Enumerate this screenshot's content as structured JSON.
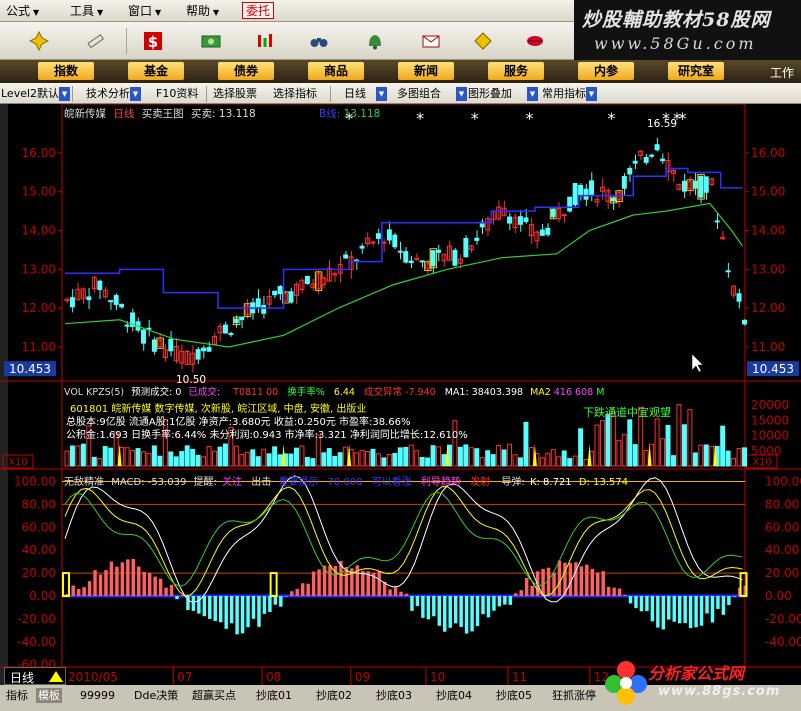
{
  "menu": {
    "items": [
      {
        "id": "formula",
        "label": "公式"
      },
      {
        "id": "tools",
        "label": "工具"
      },
      {
        "id": "window",
        "label": "窗口"
      },
      {
        "id": "help",
        "label": "帮助"
      }
    ],
    "entrust_label": "委托"
  },
  "watermark_top": {
    "title": "炒股輔助教材58股网",
    "site": "www.58Gu.com"
  },
  "toolbar_icons": [
    "cross-icon",
    "pen-icon",
    "dollar-icon",
    "money-icon",
    "candle-icon",
    "binoculars-icon",
    "bell-icon",
    "mail-icon",
    "diamond-icon",
    "lips-icon"
  ],
  "navbar": {
    "items": [
      "指数",
      "基金",
      "债券",
      "商品",
      "新闻",
      "服务",
      "内参",
      "研究室"
    ],
    "work_label": "工作"
  },
  "subbar": {
    "items": [
      "Level2默认",
      "技术分析",
      "F10资料",
      "选择股票",
      "选择指标",
      "日线",
      "多图组合",
      "图形叠加",
      "常用指标"
    ]
  },
  "price_panel": {
    "stock_name": "皖新传媒",
    "period": "日线",
    "indicator": "买卖王图",
    "buy_label": "买卖:",
    "buy_value": "13.118",
    "ma_label": "B线:",
    "ma_value": "13.118",
    "high_label": "16.59",
    "low_label": "10.50",
    "y_ticks": [
      "16.00",
      "15.00",
      "14.00",
      "13.00",
      "12.00",
      "11.00"
    ],
    "current_price": "10.453"
  },
  "volume_panel": {
    "header": [
      "VOL KPZS(5)",
      "预测成交: 0",
      "已成交:",
      "T0811 00",
      "换手率%",
      "6.44",
      "成交异常",
      "-7.940",
      "MA1: 38403.398",
      "MA2",
      "416",
      "608",
      "M"
    ],
    "info_line1": "601801 皖新传媒 数字传媒, 次新股, 皖江区域, 中盘, 安徽, 出版业",
    "info_line2": "总股本:9亿股 流通A股:1亿股 净资产:3.680元 收益:0.250元 市盈率:38.66%",
    "info_line3": "公积金:1.693 日换手率:6.44% 未分利润:0.943 市净率:3.321 净利润同比增长:12.610%",
    "warning": "下跌通道中宜观望",
    "y_ticks": [
      "20000",
      "15000",
      "10000",
      "5000"
    ],
    "unit": "X10"
  },
  "macd_panel": {
    "title": "无敌精准",
    "macd_label": "MACD: -53.039",
    "remind": "提醒:",
    "focus": "关注",
    "exit": "出击",
    "item4": "重要提示",
    "item5": "70.000",
    "item6": "可以看涨",
    "item7": "利导趋势",
    "launch": "发射",
    "guide": "导弹:",
    "k_label": "K: 8.721",
    "d_label": "D: 13.574",
    "left_ticks": [
      "100.00",
      "80.00",
      "60.00",
      "40.00",
      "20.00",
      "0.00",
      "-20.00",
      "-40.00",
      "-60.00"
    ],
    "right_ticks": [
      "100.00",
      "80.00",
      "60.00",
      "40.00",
      "20.00",
      "0.00",
      "-20.00",
      "-40.00"
    ]
  },
  "time_axis": [
    "2010/05",
    "07",
    "08",
    "09",
    "10",
    "11",
    "12"
  ],
  "period_box": "日线",
  "tabs": [
    "指标",
    "模板",
    "99999",
    "Dde决策",
    "超赢买点",
    "抄底01",
    "抄底02",
    "抄底03",
    "抄底04",
    "抄底05",
    "狂抓涨停"
  ],
  "watermark_bottom": {
    "title": "分析家公式网",
    "site": "www.88gs.com"
  },
  "colors": {
    "up": "#ff3030",
    "down": "#54ffff",
    "yellow": "#ffff00",
    "axis": "#c00000",
    "blue_line": "#2f2fff",
    "green_line": "#33cc33"
  }
}
